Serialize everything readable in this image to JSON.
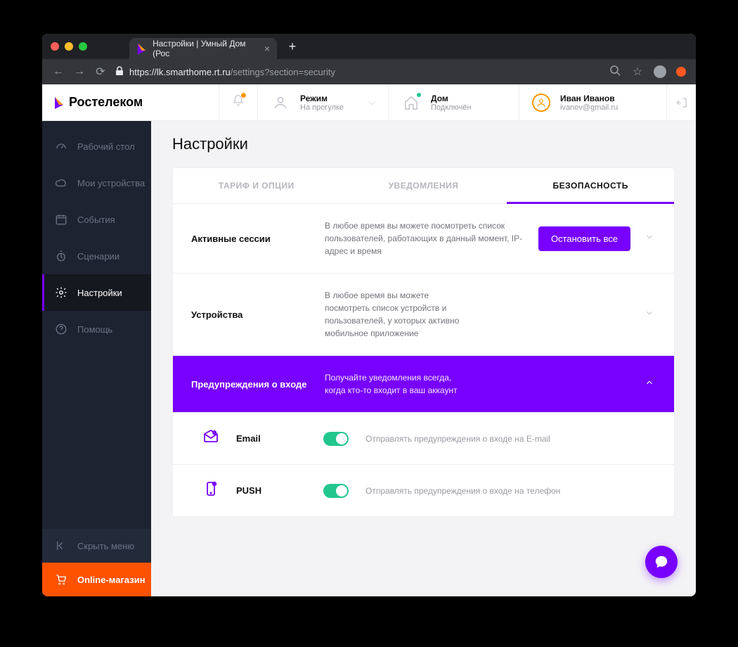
{
  "browser": {
    "tab_title": "Настройки | Умный Дом (Рос",
    "url_prefix": "https://",
    "url_host": "lk.smarthome.rt.ru",
    "url_path": "/settings?section=security"
  },
  "logo": {
    "text": "Ростелеком"
  },
  "topbar": {
    "mode": {
      "label": "Режим",
      "value": "На прогулке"
    },
    "home": {
      "label": "Дом",
      "value": "Подключён"
    },
    "user": {
      "name": "Иван Иванов",
      "email": "ivanov@gmail.ru"
    }
  },
  "sidebar": {
    "items": [
      {
        "label": "Рабочий стол"
      },
      {
        "label": "Мои устройства"
      },
      {
        "label": "События"
      },
      {
        "label": "Сценарии"
      },
      {
        "label": "Настройки"
      },
      {
        "label": "Помощь"
      }
    ],
    "hide": "Скрыть меню",
    "shop": "Online-магазин"
  },
  "page": {
    "title": "Настройки"
  },
  "tabs": [
    {
      "label": "ТАРИФ И ОПЦИИ"
    },
    {
      "label": "УВЕДОМЛЕНИЯ"
    },
    {
      "label": "БЕЗОПАСНОСТЬ"
    }
  ],
  "sections": {
    "sessions": {
      "title": "Активные сессии",
      "desc": "В любое время вы можете посмотреть список пользователей, работающих в данный момент, IP-адрес и время",
      "action": "Остановить все"
    },
    "devices": {
      "title": "Устройства",
      "desc": "В любое время вы можете посмотреть список устройств и пользователей, у которых активно мобильное приложение"
    },
    "warnings": {
      "title": "Предупреждения о входе",
      "desc": "Получайте уведомления всегда, когда кто-то входит в ваш аккаунт"
    },
    "email": {
      "label": "Email",
      "desc": "Отправлять предупреждения о входе на E-mail"
    },
    "push": {
      "label": "PUSH",
      "desc": "Отправлять предупреждения о входе на телефон"
    }
  }
}
